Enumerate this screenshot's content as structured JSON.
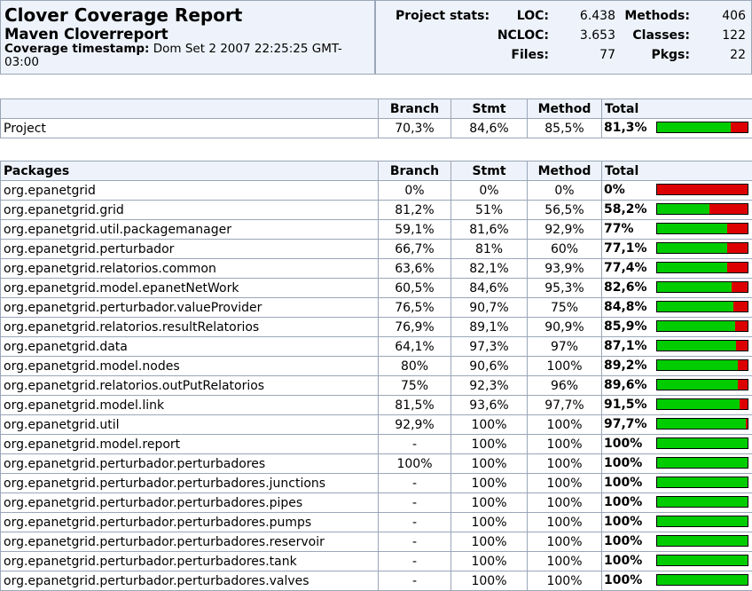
{
  "header": {
    "title": "Clover Coverage Report",
    "subtitle": "Maven Cloverreport",
    "timestamp_label": "Coverage timestamp:",
    "timestamp_value": "Dom Set 2 2007 22:25:25 GMT-03:00"
  },
  "stats": {
    "label": "Project stats:",
    "loc_label": "LOC:",
    "loc": "6.438",
    "methods_label": "Methods:",
    "methods": "406",
    "ncloc_label": "NCLOC:",
    "ncloc": "3.653",
    "classes_label": "Classes:",
    "classes": "122",
    "files_label": "Files:",
    "files": "77",
    "pkgs_label": "Pkgs:",
    "pkgs": "22"
  },
  "columns": {
    "branch": "Branch",
    "stmt": "Stmt",
    "method": "Method",
    "total": "Total"
  },
  "project": {
    "name": "Project",
    "branch": "70,3%",
    "stmt": "84,6%",
    "method": "85,5%",
    "total": "81,3%",
    "coverage": 0.813
  },
  "packages_header": "Packages",
  "packages": [
    {
      "name": "org.epanetgrid",
      "branch": "0%",
      "stmt": "0%",
      "method": "0%",
      "total": "0%",
      "coverage": 0.0
    },
    {
      "name": "org.epanetgrid.grid",
      "branch": "81,2%",
      "stmt": "51%",
      "method": "56,5%",
      "total": "58,2%",
      "coverage": 0.582
    },
    {
      "name": "org.epanetgrid.util.packagemanager",
      "branch": "59,1%",
      "stmt": "81,6%",
      "method": "92,9%",
      "total": "77%",
      "coverage": 0.77
    },
    {
      "name": "org.epanetgrid.perturbador",
      "branch": "66,7%",
      "stmt": "81%",
      "method": "60%",
      "total": "77,1%",
      "coverage": 0.771
    },
    {
      "name": "org.epanetgrid.relatorios.common",
      "branch": "63,6%",
      "stmt": "82,1%",
      "method": "93,9%",
      "total": "77,4%",
      "coverage": 0.774
    },
    {
      "name": "org.epanetgrid.model.epanetNetWork",
      "branch": "60,5%",
      "stmt": "84,6%",
      "method": "95,3%",
      "total": "82,6%",
      "coverage": 0.826
    },
    {
      "name": "org.epanetgrid.perturbador.valueProvider",
      "branch": "76,5%",
      "stmt": "90,7%",
      "method": "75%",
      "total": "84,8%",
      "coverage": 0.848
    },
    {
      "name": "org.epanetgrid.relatorios.resultRelatorios",
      "branch": "76,9%",
      "stmt": "89,1%",
      "method": "90,9%",
      "total": "85,9%",
      "coverage": 0.859
    },
    {
      "name": "org.epanetgrid.data",
      "branch": "64,1%",
      "stmt": "97,3%",
      "method": "97%",
      "total": "87,1%",
      "coverage": 0.871
    },
    {
      "name": "org.epanetgrid.model.nodes",
      "branch": "80%",
      "stmt": "90,6%",
      "method": "100%",
      "total": "89,2%",
      "coverage": 0.892
    },
    {
      "name": "org.epanetgrid.relatorios.outPutRelatorios",
      "branch": "75%",
      "stmt": "92,3%",
      "method": "96%",
      "total": "89,6%",
      "coverage": 0.896
    },
    {
      "name": "org.epanetgrid.model.link",
      "branch": "81,5%",
      "stmt": "93,6%",
      "method": "97,7%",
      "total": "91,5%",
      "coverage": 0.915
    },
    {
      "name": "org.epanetgrid.util",
      "branch": "92,9%",
      "stmt": "100%",
      "method": "100%",
      "total": "97,7%",
      "coverage": 0.977
    },
    {
      "name": "org.epanetgrid.model.report",
      "branch": "-",
      "stmt": "100%",
      "method": "100%",
      "total": "100%",
      "coverage": 1.0
    },
    {
      "name": "org.epanetgrid.perturbador.perturbadores",
      "branch": "100%",
      "stmt": "100%",
      "method": "100%",
      "total": "100%",
      "coverage": 1.0
    },
    {
      "name": "org.epanetgrid.perturbador.perturbadores.junctions",
      "branch": "-",
      "stmt": "100%",
      "method": "100%",
      "total": "100%",
      "coverage": 1.0
    },
    {
      "name": "org.epanetgrid.perturbador.perturbadores.pipes",
      "branch": "-",
      "stmt": "100%",
      "method": "100%",
      "total": "100%",
      "coverage": 1.0
    },
    {
      "name": "org.epanetgrid.perturbador.perturbadores.pumps",
      "branch": "-",
      "stmt": "100%",
      "method": "100%",
      "total": "100%",
      "coverage": 1.0
    },
    {
      "name": "org.epanetgrid.perturbador.perturbadores.reservoir",
      "branch": "-",
      "stmt": "100%",
      "method": "100%",
      "total": "100%",
      "coverage": 1.0
    },
    {
      "name": "org.epanetgrid.perturbador.perturbadores.tank",
      "branch": "-",
      "stmt": "100%",
      "method": "100%",
      "total": "100%",
      "coverage": 1.0
    },
    {
      "name": "org.epanetgrid.perturbador.perturbadores.valves",
      "branch": "-",
      "stmt": "100%",
      "method": "100%",
      "total": "100%",
      "coverage": 1.0
    }
  ],
  "colors": {
    "covered": "#00cc00",
    "uncovered": "#dd0000",
    "header_bg": "#eef3fb",
    "border": "#9aa6b8"
  }
}
